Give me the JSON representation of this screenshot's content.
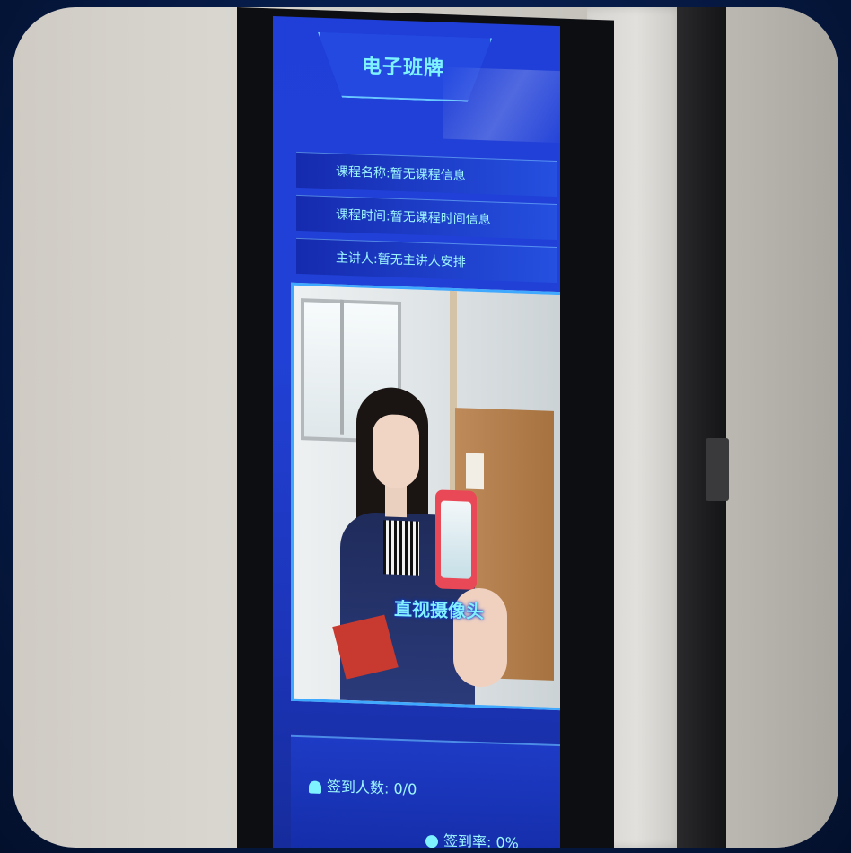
{
  "board": {
    "title": "电子班牌",
    "course_name_label": "课程名称:",
    "course_name_value": "暂无课程信息",
    "course_time_label": "课程时间:",
    "course_time_value": "暂无课程时间信息",
    "lecturer_label": "主讲人:",
    "lecturer_value": "暂无主讲人安排",
    "camera_hint": "直视摄像头",
    "signin_count_label": "签到人数:",
    "signin_count_value": "0/0",
    "signin_rate_label": "签到率:",
    "signin_rate_value": "0%"
  },
  "icons": {
    "signin_count": "user-icon",
    "signin_rate": "dot-icon"
  }
}
